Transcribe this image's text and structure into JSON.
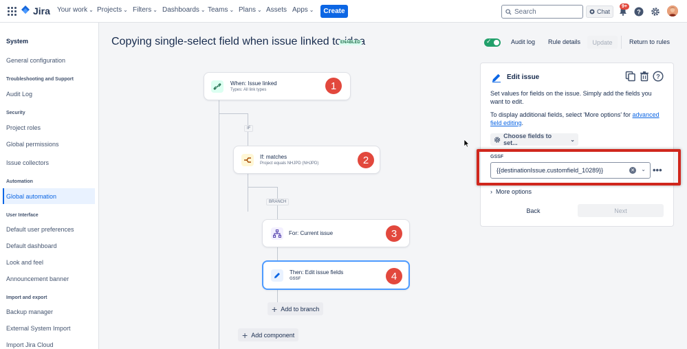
{
  "nav": {
    "logo_text": "Jira",
    "items": [
      {
        "label": "Your work"
      },
      {
        "label": "Projects"
      },
      {
        "label": "Filters"
      },
      {
        "label": "Dashboards"
      },
      {
        "label": "Teams"
      },
      {
        "label": "Plans"
      },
      {
        "label": "Assets"
      },
      {
        "label": "Apps"
      }
    ],
    "create_label": "Create",
    "search_placeholder": "Search",
    "chat_label": "Chat",
    "notifications_badge": "9+"
  },
  "sidebar": {
    "title": "System",
    "sections": [
      {
        "heading": "",
        "items": [
          "General configuration"
        ]
      },
      {
        "heading": "Troubleshooting and Support",
        "items": [
          "Audit Log"
        ]
      },
      {
        "heading": "Security",
        "items": [
          "Project roles",
          "Global permissions",
          "Issue collectors"
        ]
      },
      {
        "heading": "Automation",
        "items": [
          "Global automation"
        ]
      },
      {
        "heading": "User Interface",
        "items": [
          "Default user preferences",
          "Default dashboard",
          "Look and feel",
          "Announcement banner"
        ]
      },
      {
        "heading": "Import and export",
        "items": [
          "Backup manager",
          "External System Import",
          "Import Jira Cloud"
        ]
      }
    ],
    "active_item": "Global automation"
  },
  "rule": {
    "title": "Copying single-select field when issue linked to idea",
    "status": "ENABLED",
    "enabled": true,
    "audit_log_label": "Audit log",
    "rule_details_label": "Rule details",
    "update_label": "Update",
    "return_label": "Return to rules"
  },
  "flow": {
    "trigger": {
      "title": "When: Issue linked",
      "subtitle": "Types: All link types",
      "number": "1"
    },
    "if_tag": "IF",
    "condition": {
      "title": "If: matches",
      "subtitle": "Project equals NHJPD (NHJPD)",
      "number": "2"
    },
    "branch_tag": "BRANCH",
    "branch": {
      "title": "For: Current issue",
      "number": "3"
    },
    "action": {
      "title": "Then: Edit issue fields",
      "subtitle": "GSSF",
      "number": "4"
    },
    "add_to_branch_label": "Add to branch",
    "add_component_label": "Add component"
  },
  "panel": {
    "title": "Edit issue",
    "description": "Set values for fields on the issue. Simply add the fields you want to edit.",
    "more_fields_prefix": "To display additional fields, select 'More options' for ",
    "more_fields_link": "advanced field editing",
    "more_fields_suffix": ".",
    "choose_fields_label": "Choose fields to set...",
    "field_label": "GSSF",
    "field_value": "{{destinationIssue.customfield_10289}}",
    "more_options_label": "More options",
    "back_label": "Back",
    "next_label": "Next"
  },
  "colors": {
    "brand_blue": "#0c66e4",
    "badge_red": "#e2483d",
    "highlight_red": "#d0271d",
    "toggle_green": "#22a06b"
  }
}
